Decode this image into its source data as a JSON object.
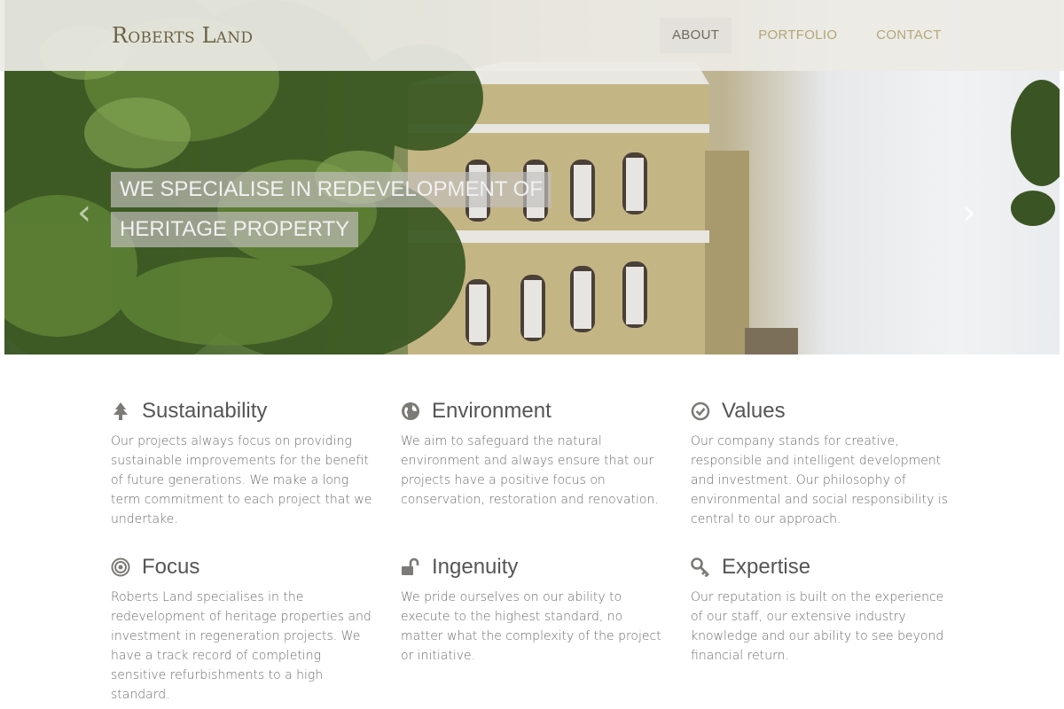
{
  "header": {
    "logo": "Roberts Land",
    "nav": [
      {
        "label": "ABOUT",
        "active": true
      },
      {
        "label": "PORTFOLIO",
        "active": false
      },
      {
        "label": "CONTACT",
        "active": false
      }
    ]
  },
  "hero": {
    "caption_line1": "WE SPECIALISE IN REDEVELOPMENT OF",
    "caption_line2": "HERITAGE PROPERTY",
    "prev_icon": "chevron-left-icon",
    "next_icon": "chevron-right-icon"
  },
  "features": [
    {
      "icon": "tree-icon",
      "title": "Sustainability",
      "text": "Our projects always focus on providing sustainable improvements for the benefit of future generations. We make a long term commitment to each project that we undertake."
    },
    {
      "icon": "globe-icon",
      "title": "Environment",
      "text": "We aim to safeguard the natural environment and always ensure that our projects have a positive focus on conservation, restoration and renovation."
    },
    {
      "icon": "check-circle-icon",
      "title": "Values",
      "text": "Our company stands for creative, responsible and intelligent development and investment. Our philosophy of environmental and social responsibility is central to our approach."
    },
    {
      "icon": "target-icon",
      "title": "Focus",
      "text": "Roberts Land specialises in the redevelopment of heritage properties and investment in regeneration projects. We have a track record of completing sensitive refurbishments to a high standard."
    },
    {
      "icon": "unlock-icon",
      "title": "Ingenuity",
      "text": "We pride ourselves on our ability to execute to the highest standard, no matter what the complexity of the project or initiative."
    },
    {
      "icon": "key-icon",
      "title": "Expertise",
      "text": "Our reputation is built on the experience of our staff, our extensive industry knowledge and our ability to see beyond financial return."
    }
  ],
  "colors": {
    "accent": "#b3a676",
    "logo": "#6b6245",
    "heading": "#555555",
    "body": "#6c6c6c"
  }
}
